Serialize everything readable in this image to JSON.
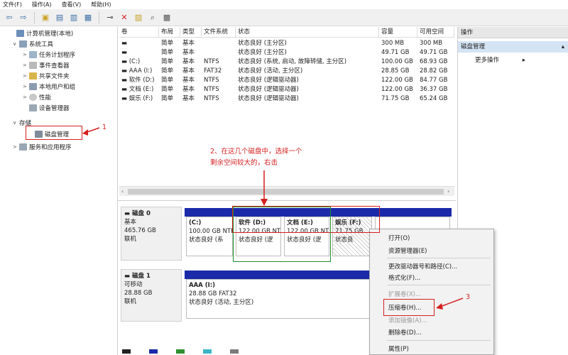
{
  "menubar": {
    "items": [
      "文件(F)",
      "操作(A)",
      "查看(V)",
      "帮助(H)"
    ]
  },
  "toolbar": {
    "icons": [
      "back-icon",
      "forward-icon",
      "up-icon",
      "console-tree-icon",
      "properties-icon",
      "help-icon",
      "connect-icon",
      "delete-icon",
      "open-icon",
      "search-icon",
      "format-icon"
    ]
  },
  "tree": {
    "items": [
      {
        "label": "计算机管理(本地)",
        "expander": ""
      },
      {
        "label": "系统工具",
        "expander": "∨"
      },
      {
        "label": "任务计划程序",
        "expander": ">"
      },
      {
        "label": "事件查看器",
        "expander": ">"
      },
      {
        "label": "共享文件夹",
        "expander": ">"
      },
      {
        "label": "本地用户和组",
        "expander": ">"
      },
      {
        "label": "性能",
        "expander": ">"
      },
      {
        "label": "设备管理器",
        "expander": ""
      },
      {
        "label": "存储",
        "expander": "∨"
      },
      {
        "label": "磁盘管理",
        "expander": ""
      },
      {
        "label": "服务和应用程序",
        "expander": ">"
      }
    ]
  },
  "volume_table": {
    "headers": [
      "卷",
      "布局",
      "类型",
      "文件系统",
      "状态",
      "容量",
      "可用空间"
    ],
    "rows": [
      [
        "",
        "简单",
        "基本",
        "",
        "状态良好 (主分区)",
        "300 MB",
        "300 MB"
      ],
      [
        "",
        "简单",
        "基本",
        "",
        "状态良好 (主分区)",
        "49.71 GB",
        "49.71 GB"
      ],
      [
        "(C:)",
        "简单",
        "基本",
        "NTFS",
        "状态良好 (系统, 启动, 故障转储, 主分区)",
        "100.00 GB",
        "68.93 GB"
      ],
      [
        "AAA (I:)",
        "简单",
        "基本",
        "FAT32",
        "状态良好 (活动, 主分区)",
        "28.85 GB",
        "28.82 GB"
      ],
      [
        "软件 (D:)",
        "简单",
        "基本",
        "NTFS",
        "状态良好 (逻辑驱动器)",
        "122.00 GB",
        "84.77 GB"
      ],
      [
        "文档 (E:)",
        "简单",
        "基本",
        "NTFS",
        "状态良好 (逻辑驱动器)",
        "122.00 GB",
        "36.37 GB"
      ],
      [
        "娱乐 (F:)",
        "简单",
        "基本",
        "NTFS",
        "状态良好 (逻辑驱动器)",
        "71.75 GB",
        "65.24 GB"
      ]
    ]
  },
  "disks": [
    {
      "name": "磁盘 0",
      "type": "基本",
      "size": "465.76 GB",
      "status": "联机",
      "partitions": [
        {
          "name": "(C:)",
          "size": "100.00 GB NTFS",
          "status": "状态良好 (系"
        },
        {
          "name": "软件 (D:)",
          "size": "122.00 GB NT",
          "status": "状态良好 (逻"
        },
        {
          "name": "文档 (E:)",
          "size": "122.00 GB NT",
          "status": "状态良好 (逻"
        },
        {
          "name": "娱乐 (F:)",
          "size": "71.75 GB",
          "status": "状态良"
        }
      ]
    },
    {
      "name": "磁盘 1",
      "type": "可移动",
      "size": "28.88 GB",
      "status": "联机",
      "partitions": [
        {
          "name": "AAA (I:)",
          "size": "28.88 GB FAT32",
          "status": "状态良好 (活动, 主分区)"
        }
      ]
    }
  ],
  "actions": {
    "header": "操作",
    "section": "磁盘管理",
    "more": "更多操作"
  },
  "context_menu": {
    "items": [
      {
        "label": "打开(O)",
        "enabled": true
      },
      {
        "label": "资源管理器(E)",
        "enabled": true
      },
      {
        "label": "更改驱动器号和路径(C)...",
        "enabled": true
      },
      {
        "label": "格式化(F)...",
        "enabled": true
      },
      {
        "label": "扩展卷(X)...",
        "enabled": false
      },
      {
        "label": "压缩卷(H)...",
        "enabled": true
      },
      {
        "label": "添加镜像(A)...",
        "enabled": false
      },
      {
        "label": "删除卷(D)...",
        "enabled": true
      },
      {
        "label": "属性(P)",
        "enabled": true
      }
    ]
  },
  "annotations": {
    "step1": "1",
    "step2_line1": "2、在这几个磁盘中，选择一个",
    "step2_line2": "剩余空间较大的，右击",
    "step3": "3"
  },
  "colors": {
    "annotation": "#d41f1f",
    "partition_bar": "#1b2aa8",
    "selection": "#1f8f2f",
    "action_section": "#d4e4f5"
  }
}
